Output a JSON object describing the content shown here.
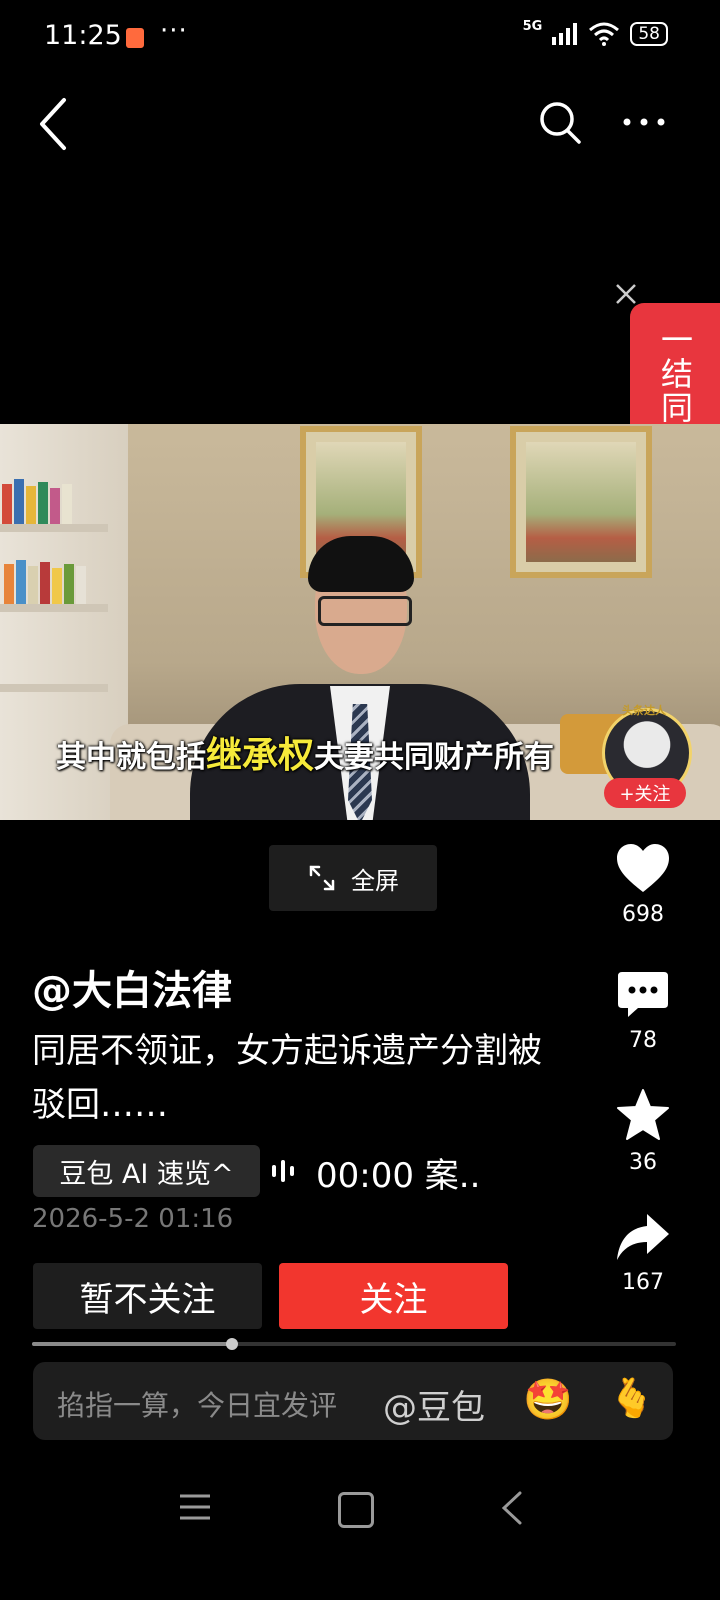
{
  "status_bar": {
    "time": "11:25",
    "dots": "···",
    "network": "5G",
    "battery": "58"
  },
  "promo": {
    "text": "一结同心"
  },
  "video": {
    "subtitle_pre": "其中就包括",
    "subtitle_highlight": "继承权",
    "subtitle_post": "夫妻共同财产所有",
    "creator_badge_label": "头条达人",
    "creator_follow": "+关注"
  },
  "fullscreen_label": "全屏",
  "actions": {
    "likes": "698",
    "comments": "78",
    "favorites": "36",
    "shares": "167"
  },
  "post": {
    "author": "@大白法律",
    "description": "同居不领证，女方起诉遗产分割被驳回……",
    "ai_summary_label": "豆包 AI 速览^",
    "audio_text": "00:00 案..",
    "date": "2026-5-2 01:16"
  },
  "buttons": {
    "unfollow": "暂不关注",
    "follow": "关注"
  },
  "playback": {
    "progress": 0.31
  },
  "comment_bar": {
    "placeholder": "掐指一算，今日宜发评",
    "mention": "@豆包",
    "emoji": "🤩",
    "heart_hand": "🫰"
  }
}
